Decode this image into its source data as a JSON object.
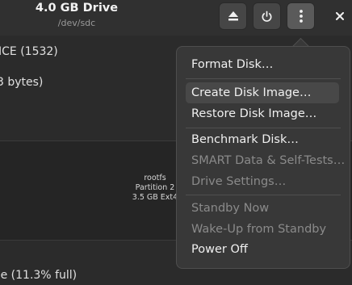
{
  "header": {
    "title": "4.0 GB Drive",
    "subtitle": "/dev/sdc",
    "buttons": [
      "eject-icon",
      "power-icon",
      "more-icon"
    ],
    "close_icon": "close-icon"
  },
  "content": {
    "model_text": "ICE (1532)",
    "size_text": "3 bytes)",
    "partition": {
      "name": "rootfs",
      "label": "Partition 2",
      "size": "3.5 GB Ext4"
    },
    "usage_text": "ee (11.3% full)"
  },
  "menu": {
    "items": [
      {
        "label": "Format Disk…",
        "enabled": true
      },
      {
        "label": "Create Disk Image…",
        "enabled": true,
        "hover": true
      },
      {
        "label": "Restore Disk Image…",
        "enabled": true
      },
      {
        "label": "Benchmark Disk…",
        "enabled": true
      },
      {
        "label": "SMART Data & Self-Tests…",
        "enabled": false
      },
      {
        "label": "Drive Settings…",
        "enabled": false
      },
      {
        "label": "Standby Now",
        "enabled": false
      },
      {
        "label": "Wake-Up from Standby",
        "enabled": false
      },
      {
        "label": "Power Off",
        "enabled": true
      }
    ]
  }
}
